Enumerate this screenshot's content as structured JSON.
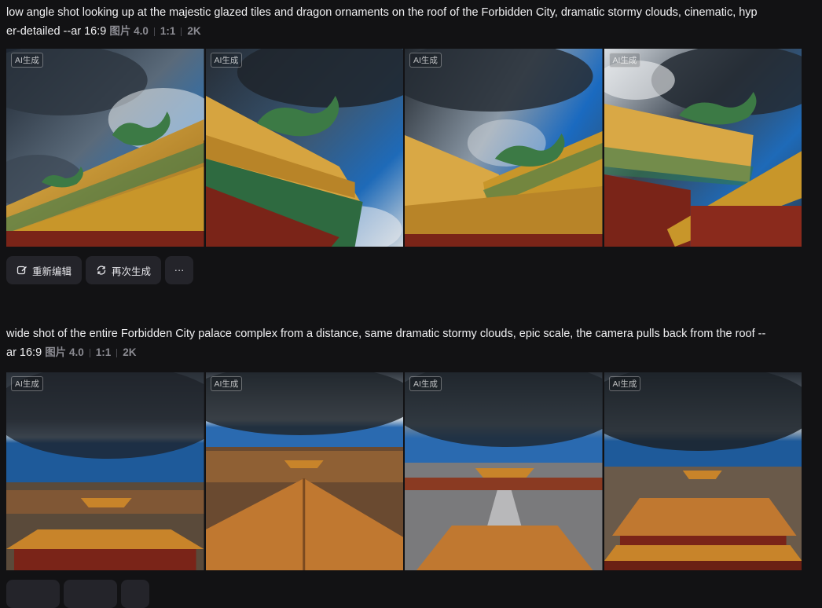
{
  "items": [
    {
      "prompt": "low angle shot looking up at the majestic glazed tiles and dragon ornaments on the roof of the Forbidden City, dramatic stormy clouds, cinematic, hyper-detailed --ar 16:9",
      "prompt_line1": "low angle shot looking up at the majestic glazed tiles and dragon ornaments on the roof of the Forbidden City, dramatic stormy clouds, cinematic, hyp",
      "prompt_line2": "er-detailed --ar 16:9",
      "model": "图片 4.0",
      "ratio": "1:1",
      "resolution": "2K",
      "badge": "AI生成"
    },
    {
      "prompt": "wide shot of the entire Forbidden City palace complex from a distance, same dramatic stormy clouds, epic scale, the camera pulls back from the roof --ar 16:9",
      "prompt_line1": "wide shot of the entire Forbidden City palace complex from a distance, same dramatic stormy clouds, epic scale, the camera pulls back from the roof --",
      "prompt_line2": "ar 16:9",
      "model": "图片 4.0",
      "ratio": "1:1",
      "resolution": "2K",
      "badge": "AI生成"
    }
  ],
  "actions": {
    "reedit_label": "重新编辑",
    "regenerate_label": "再次生成",
    "more_label": "···"
  },
  "icons": {
    "reedit": "edit-icon",
    "regenerate": "refresh-icon",
    "more": "more-horizontal-icon"
  },
  "colors": {
    "background": "#121214",
    "button": "#24242a",
    "meta_text": "#8b8b92",
    "roof_gold": "#c8962a",
    "wall_red": "#7a2418",
    "sky_blue": "#2a6fb0"
  }
}
